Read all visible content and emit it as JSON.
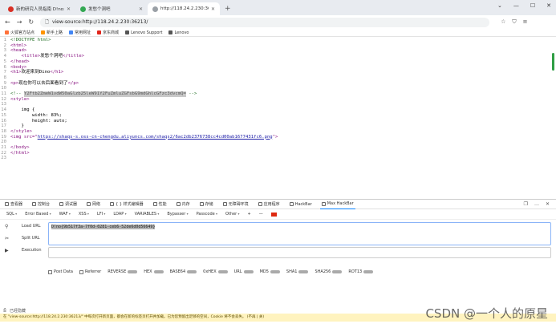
{
  "tabs": [
    {
      "label": "新的研究人员指南  D!no:CTF",
      "icon_color": "#d93025"
    },
    {
      "label": "发愁个洞吧",
      "icon_color": "#34a853"
    },
    {
      "label": "http://118.24.2.230:36213/",
      "icon_color": "#9aa0a6"
    }
  ],
  "address": {
    "url": "view-source:http://118.24.2.230:36213/"
  },
  "bookmarks": [
    {
      "label": "火狐官方站点",
      "color": "#ff7139"
    },
    {
      "label": "新手上路",
      "color": "#ff9400"
    },
    {
      "label": "常用网址",
      "color": "#4285f4"
    },
    {
      "label": "京东商城",
      "color": "#e1251b"
    },
    {
      "label": "Lenovo Support",
      "color": "#555555"
    },
    {
      "label": "Lenovo",
      "color": "#555555"
    }
  ],
  "source_lines": [
    {
      "n": "1",
      "parts": [
        {
          "t": "<!DOCTYPE html>",
          "c": "comment"
        }
      ]
    },
    {
      "n": "2",
      "parts": [
        {
          "t": "<html>",
          "c": "code"
        }
      ]
    },
    {
      "n": "3",
      "parts": [
        {
          "t": "<head>",
          "c": "code"
        }
      ]
    },
    {
      "n": "4",
      "parts": [
        {
          "t": "    ",
          "c": "txt"
        },
        {
          "t": "<title>",
          "c": "code"
        },
        {
          "t": "发愁个洞吧",
          "c": "txt"
        },
        {
          "t": "</title>",
          "c": "code"
        }
      ]
    },
    {
      "n": "5",
      "parts": [
        {
          "t": "</head>",
          "c": "code"
        }
      ]
    },
    {
      "n": "6",
      "parts": [
        {
          "t": "<body>",
          "c": "code"
        }
      ]
    },
    {
      "n": "7",
      "parts": [
        {
          "t": "<h1>",
          "c": "code"
        },
        {
          "t": "欢迎来到Dino",
          "c": "txt"
        },
        {
          "t": "</h1>",
          "c": "code"
        }
      ]
    },
    {
      "n": "8",
      "parts": []
    },
    {
      "n": "9",
      "parts": [
        {
          "t": "<p>",
          "c": "code"
        },
        {
          "t": "现在你可以去后面看到了",
          "c": "txt"
        },
        {
          "t": "</p>",
          "c": "code"
        }
      ]
    },
    {
      "n": "10",
      "parts": []
    },
    {
      "n": "11",
      "parts": [
        {
          "t": "<!-- ",
          "c": "comment"
        },
        {
          "t": "Y2Ftb2ZmeW1vdW50aGlzb25leW91Y2FuZmluZGFsbG9mdGhlcGFzc3dvcmQ=",
          "c": "sel"
        },
        {
          "t": " -->",
          "c": "comment"
        }
      ]
    },
    {
      "n": "12",
      "parts": [
        {
          "t": "<style>",
          "c": "code"
        }
      ]
    },
    {
      "n": "13",
      "parts": []
    },
    {
      "n": "14",
      "parts": [
        {
          "t": "    img {",
          "c": "txt"
        }
      ]
    },
    {
      "n": "15",
      "parts": [
        {
          "t": "        width: 83%;",
          "c": "txt"
        }
      ]
    },
    {
      "n": "16",
      "parts": [
        {
          "t": "        height: auto;",
          "c": "txt"
        }
      ]
    },
    {
      "n": "17",
      "parts": [
        {
          "t": "    }",
          "c": "txt"
        }
      ]
    },
    {
      "n": "18",
      "parts": [
        {
          "t": "</style>",
          "c": "code"
        }
      ]
    },
    {
      "n": "19",
      "parts": [
        {
          "t": "<img src=\"",
          "c": "code"
        },
        {
          "t": "https://shaqs-s.oss-cn-chengdu.aliyuncs.com/shaqs2/6ac2db2376738cc4cd00ab1677431fc6.png",
          "c": "lnk"
        },
        {
          "t": "\">",
          "c": "code"
        }
      ]
    },
    {
      "n": "20",
      "parts": []
    },
    {
      "n": "21",
      "parts": [
        {
          "t": "</body>",
          "c": "code"
        }
      ]
    },
    {
      "n": "22",
      "parts": [
        {
          "t": "</html>",
          "c": "code"
        }
      ]
    },
    {
      "n": "23",
      "parts": []
    }
  ],
  "devtools_tabs": [
    "查看器",
    "控制台",
    "调试器",
    "网络",
    "{ } 样式编辑器",
    "性能",
    "内存",
    "存储",
    "无障碍环境",
    "应用程序",
    "HackBar",
    "Max HackBar"
  ],
  "hackbar_toolbar": [
    "SQL",
    "Error Based",
    "WAF",
    "XSS",
    "LFI",
    "LDAP",
    "VARIABLES",
    "Bypasser",
    "Passcode",
    "Other",
    "+",
    "—"
  ],
  "hackbar": {
    "labels": [
      "Load URL",
      "Split URL",
      "Execution"
    ],
    "url_value": "D!no{9b517f3a-7f0d-0281-ceb6-52de6d0d56649}",
    "checkboxes": [
      "Post Data",
      "Referrer"
    ],
    "encoders": [
      "REVERSE",
      "HEX",
      "BASE64",
      "0xHEX",
      "URL",
      "MD5",
      "SHA1",
      "SHA256",
      "ROT13"
    ]
  },
  "status": {
    "line1": "已经隐藏",
    "line2": "在 \"view-source:http://118.24.2.230:36213/\" 中每次打开新页面，都会在新的标签页打开并加载。已为您预留出足够的空间，Cookie 将不会丢失。 (不再 | 关)"
  },
  "watermark": "CSDN @一个人的原星"
}
